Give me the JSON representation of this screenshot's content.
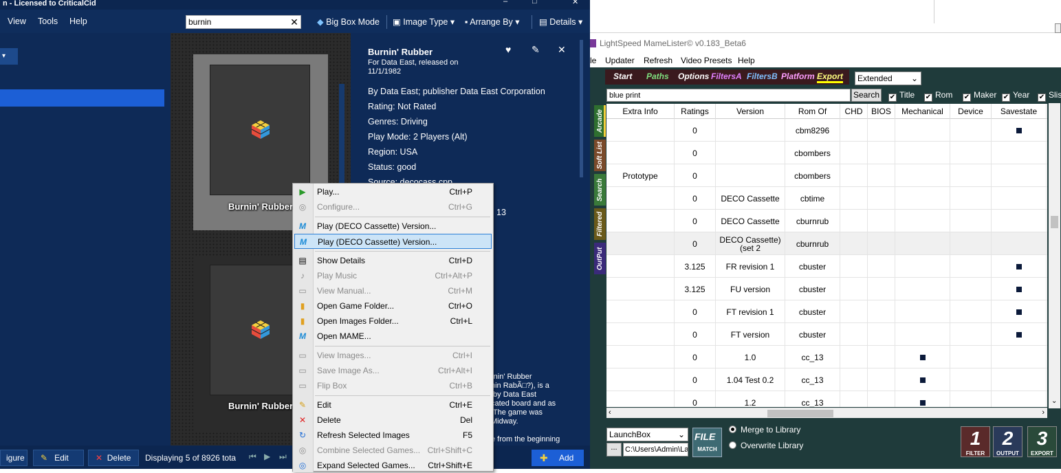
{
  "launchbox": {
    "title": "n - Licensed to CriticalCid",
    "menu": [
      "View",
      "Tools",
      "Help"
    ],
    "search_value": "burnin",
    "toolbar": {
      "bigbox": "Big Box Mode",
      "image_type": "Image Type ▾",
      "arrange_by": "Arrange By ▾",
      "details": "Details ▾"
    },
    "cards": [
      {
        "label": "Burnin' Rubber"
      },
      {
        "label": "Burnin' Rubber"
      }
    ],
    "details": {
      "title": "Burnin' Rubber",
      "subtitle": "For Data East, released on 11/1/1982",
      "lines": [
        "By Data East; publisher Data East Corporation",
        "Rating: Not Rated",
        "Genres: Driving",
        "Play Mode: 2 Players (Alt)",
        "Region: USA",
        "Status: good",
        "Source: decocass.cpp"
      ],
      "partial": "13",
      "desc": "rnin' Rubber\nnin RabÃ□?), is a\n by Data East\ncated board and as\n The game was\nMidway.",
      "desc2": "e from the beginning"
    },
    "bottom": {
      "configure": "igure",
      "edit": "Edit",
      "delete": "Delete",
      "status": "Displaying 5 of 8926 tota",
      "add": "Add"
    }
  },
  "context_menu": {
    "items": [
      {
        "icon": "play-icon",
        "glyph": "▶",
        "label": "Play...",
        "shortcut": "Ctrl+P",
        "disabled": false
      },
      {
        "icon": "configure-icon",
        "glyph": "◎",
        "label": "Configure...",
        "shortcut": "Ctrl+G",
        "disabled": true
      },
      {
        "sep": true
      },
      {
        "icon": "mame-icon",
        "glyph": "M",
        "label": "Play (DECO Cassette) Version...",
        "shortcut": "",
        "disabled": false
      },
      {
        "icon": "mame-icon",
        "glyph": "M",
        "label": "Play (DECO Cassette) Version...",
        "shortcut": "",
        "disabled": false,
        "highlight": true
      },
      {
        "sep": true
      },
      {
        "icon": "details-icon",
        "glyph": "▤",
        "label": "Show Details",
        "shortcut": "Ctrl+D",
        "disabled": false
      },
      {
        "icon": "music-icon",
        "glyph": "♪",
        "label": "Play Music",
        "shortcut": "Ctrl+Alt+P",
        "disabled": true
      },
      {
        "icon": "manual-icon",
        "glyph": "▭",
        "label": "View Manual...",
        "shortcut": "Ctrl+M",
        "disabled": true
      },
      {
        "icon": "folder-icon",
        "glyph": "▮",
        "label": "Open Game Folder...",
        "shortcut": "Ctrl+O",
        "disabled": false
      },
      {
        "icon": "images-folder-icon",
        "glyph": "▮",
        "label": "Open Images Folder...",
        "shortcut": "Ctrl+L",
        "disabled": false
      },
      {
        "icon": "mame-icon",
        "glyph": "M",
        "label": "Open MAME...",
        "shortcut": "",
        "disabled": false
      },
      {
        "sep": true
      },
      {
        "icon": "images-icon",
        "glyph": "▭",
        "label": "View Images...",
        "shortcut": "Ctrl+I",
        "disabled": true
      },
      {
        "icon": "save-icon",
        "glyph": "▭",
        "label": "Save Image As...",
        "shortcut": "Ctrl+Alt+I",
        "disabled": true
      },
      {
        "icon": "flip-icon",
        "glyph": "▭",
        "label": "Flip Box",
        "shortcut": "Ctrl+B",
        "disabled": true
      },
      {
        "sep": true
      },
      {
        "icon": "edit-icon",
        "glyph": "✎",
        "label": "Edit",
        "shortcut": "Ctrl+E",
        "disabled": false
      },
      {
        "icon": "delete-icon",
        "glyph": "✕",
        "label": "Delete",
        "shortcut": "Del",
        "disabled": false
      },
      {
        "icon": "refresh-icon",
        "glyph": "↻",
        "label": "Refresh Selected Images",
        "shortcut": "F5",
        "disabled": false
      },
      {
        "icon": "combine-icon",
        "glyph": "◎",
        "label": "Combine Selected Games...",
        "shortcut": "Ctrl+Shift+C",
        "disabled": true
      },
      {
        "icon": "expand-icon",
        "glyph": "◎",
        "label": "Expand Selected Games...",
        "shortcut": "Ctrl+Shift+E",
        "disabled": false
      }
    ]
  },
  "mamelister": {
    "title": "LightSpeed MameLister© v0.183_Beta6",
    "menu": [
      "le",
      "Updater",
      "Refresh",
      "Video Presets",
      "Help"
    ],
    "tabs": [
      {
        "label": "Start",
        "color": "#ffffff"
      },
      {
        "label": "Paths",
        "color": "#7fe07f"
      },
      {
        "label": "Options",
        "color": "#ffffff"
      },
      {
        "label": "FiltersA",
        "color": "#e080ff"
      },
      {
        "label": "FiltersB",
        "color": "#80c0ff"
      },
      {
        "label": "Platform",
        "color": "#ff9fff"
      },
      {
        "label": "Export",
        "color": "#ffff80"
      }
    ],
    "preset": "Extended",
    "search_value": "blue print",
    "search_btn": "Search",
    "checks": [
      "Title",
      "Rom",
      "Maker",
      "Year",
      "Slist"
    ],
    "side_tabs": [
      {
        "label": "Arcade",
        "color": "#3a8a3a"
      },
      {
        "label": "Soft List",
        "color": "#7a4a2a"
      },
      {
        "label": "Search",
        "color": "#3a7a3a"
      },
      {
        "label": "Filtered",
        "color": "#6a5a1a"
      },
      {
        "label": "OutPut",
        "color": "#3a2a7a"
      }
    ],
    "columns": [
      "Extra Info",
      "Ratings",
      "Version",
      "Rom Of",
      "CHD",
      "BIOS",
      "Mechanical",
      "Device",
      "Savestate"
    ],
    "rows": [
      {
        "extra": "",
        "rating": "0",
        "version": "",
        "romof": "cbm8296",
        "mech": false,
        "save": true
      },
      {
        "extra": "",
        "rating": "0",
        "version": "",
        "romof": "cbombers",
        "mech": false,
        "save": false
      },
      {
        "extra": "Prototype",
        "rating": "0",
        "version": "",
        "romof": "cbombers",
        "mech": false,
        "save": false
      },
      {
        "extra": "",
        "rating": "0",
        "version": "DECO Cassette",
        "romof": "cbtime",
        "mech": false,
        "save": false
      },
      {
        "extra": "",
        "rating": "0",
        "version": "DECO Cassette",
        "romof": "cburnrub",
        "mech": false,
        "save": false
      },
      {
        "extra": "",
        "rating": "0",
        "version": "DECO Cassette)\n(set 2",
        "romof": "cburnrub",
        "mech": false,
        "save": false,
        "alt": true
      },
      {
        "extra": "",
        "rating": "3.125",
        "version": "FR revision 1",
        "romof": "cbuster",
        "mech": false,
        "save": true
      },
      {
        "extra": "",
        "rating": "3.125",
        "version": "FU version",
        "romof": "cbuster",
        "mech": false,
        "save": true
      },
      {
        "extra": "",
        "rating": "0",
        "version": "FT revision 1",
        "romof": "cbuster",
        "mech": false,
        "save": true
      },
      {
        "extra": "",
        "rating": "0",
        "version": "FT version",
        "romof": "cbuster",
        "mech": false,
        "save": true
      },
      {
        "extra": "",
        "rating": "0",
        "version": "1.0",
        "romof": "cc_13",
        "mech": true,
        "save": false
      },
      {
        "extra": "",
        "rating": "0",
        "version": "1.04 Test 0.2",
        "romof": "cc_13",
        "mech": true,
        "save": false
      },
      {
        "extra": "",
        "rating": "0",
        "version": "1.2",
        "romof": "cc_13",
        "mech": true,
        "save": false
      }
    ],
    "bottom": {
      "launcher": "LaunchBox",
      "dots": "...",
      "path": "C:\\Users\\Admin\\La",
      "file_match": "MATCH",
      "merge": "Merge to Library",
      "overwrite": "Overwrite Library",
      "btns": [
        {
          "num": "1",
          "label": "FILTER"
        },
        {
          "num": "2",
          "label": "OUTPUT"
        },
        {
          "num": "3",
          "label": "EXPORT"
        }
      ]
    }
  }
}
